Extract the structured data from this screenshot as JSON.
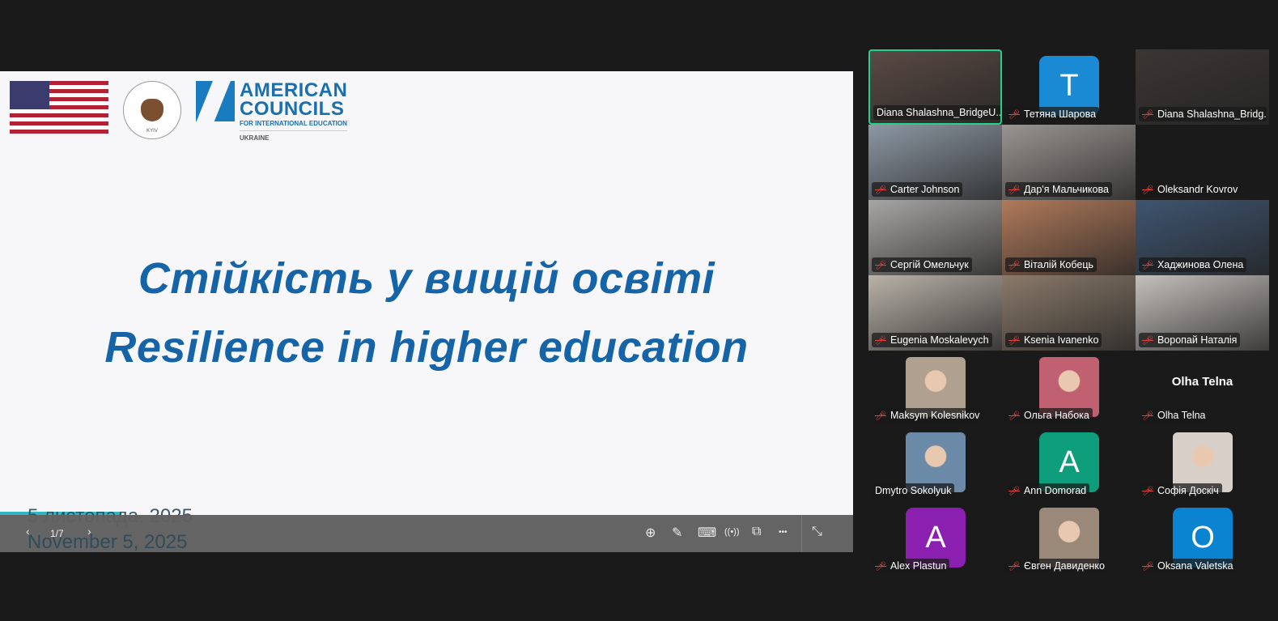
{
  "slide": {
    "logos": {
      "embassy_top": "UNITED STATES EMBASSY",
      "embassy_bottom": "KYIV",
      "org_line1": "AMERICAN",
      "org_line2": "COUNCILS",
      "org_line3": "FOR INTERNATIONAL EDUCATION",
      "org_country": "UKRAINE"
    },
    "title_uk": "Стійкість у вищій освіті",
    "title_en": "Resilience in higher education",
    "date_uk": "5 листопада, 2025",
    "date_en": "November 5, 2025"
  },
  "toolbar": {
    "page": "1/7",
    "prev": "‹",
    "next": "›",
    "zoom": "⊕",
    "annotate": "✎",
    "keyboard": "⌨",
    "broadcast": "((•))",
    "window": "⧉",
    "more": "•••",
    "exit": "⤡"
  },
  "participants": [
    {
      "name": "Diana Shalashna_BridgeU...",
      "type": "video",
      "muted": false,
      "active": true,
      "bg": "#5a4a44"
    },
    {
      "name": "Тетяна Шарова",
      "type": "avatar",
      "letter": "T",
      "color": "#1a8ad4",
      "muted": true
    },
    {
      "name": "Diana Shalashna_Bridg...",
      "type": "video",
      "muted": true,
      "bg": "#3a3634"
    },
    {
      "name": "Carter Johnson",
      "type": "video",
      "muted": true,
      "bg": "#8d98a3"
    },
    {
      "name": "Дар'я Мальчикова",
      "type": "video",
      "muted": true,
      "bg": "#9a9592"
    },
    {
      "name": "Oleksandr Kovrov",
      "type": "blank",
      "muted": true
    },
    {
      "name": "Сергій Омельчук",
      "type": "video",
      "muted": true,
      "bg": "#a8a6a4"
    },
    {
      "name": "Віталій Кобець",
      "type": "video",
      "muted": true,
      "bg": "#b07a5a"
    },
    {
      "name": "Хаджинова Олена",
      "type": "video",
      "muted": true,
      "bg": "#3e5570"
    },
    {
      "name": "Eugenia Moskalevych",
      "type": "video",
      "muted": true,
      "bg": "#b9b2a8"
    },
    {
      "name": "Ksenia Ivanenko",
      "type": "video",
      "muted": true,
      "bg": "#8a7a6a"
    },
    {
      "name": "Воропай Наталія",
      "type": "video",
      "muted": true,
      "bg": "#c4c0bc"
    },
    {
      "name": "Maksym Kolesnikov",
      "type": "photo",
      "muted": true,
      "bg": "#b0a090"
    },
    {
      "name": "Ольга Набока",
      "type": "photo",
      "muted": true,
      "bg": "#c06070"
    },
    {
      "name": "Olha Telna",
      "type": "text",
      "label": "Olha Telna",
      "muted": true
    },
    {
      "name": "Dmytro Sokolyuk",
      "type": "photo",
      "muted": false,
      "bg": "#6a8aa8"
    },
    {
      "name": "Ann Domorad",
      "type": "avatar",
      "letter": "A",
      "color": "#0e9e7c",
      "muted": true
    },
    {
      "name": "Софія Доскіч",
      "type": "photo",
      "muted": true,
      "bg": "#d8cfc8"
    },
    {
      "name": "Alex Plastun",
      "type": "avatar",
      "letter": "A",
      "color": "#8b1fb0",
      "muted": true
    },
    {
      "name": "Євген Давиденко",
      "type": "photo",
      "muted": true,
      "bg": "#9a8878"
    },
    {
      "name": "Oksana Valetska",
      "type": "avatar",
      "letter": "O",
      "color": "#0a84d0",
      "muted": true
    }
  ]
}
